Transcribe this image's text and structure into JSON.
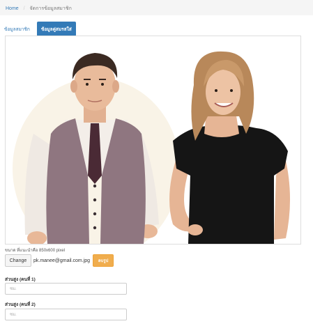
{
  "breadcrumb": {
    "home": "Home",
    "current": "จัดการข้อมูลสมาชิก"
  },
  "tabs": [
    {
      "label": "ข้อมูลสมาชิก",
      "active": false
    },
    {
      "label": "ข้อมูลคู่สมรสใส่",
      "active": true
    }
  ],
  "photo": {
    "description_icon": "couple-photo"
  },
  "upload": {
    "hint": "ขนาด ที่แนะนำคือ 850x600 pixel",
    "change_label": "Change",
    "filename": "pk.manee@gmail.com.jpg",
    "remove_label": "ลบรูป"
  },
  "fields": [
    {
      "label": "ส่วนสูง (คนที่ 1)",
      "placeholder": "ซม."
    },
    {
      "label": "ส่วนสูง (คนที่ 2)",
      "placeholder": "ซม."
    }
  ],
  "colors": {
    "primary": "#337ab7",
    "warning": "#f0ad4e"
  }
}
